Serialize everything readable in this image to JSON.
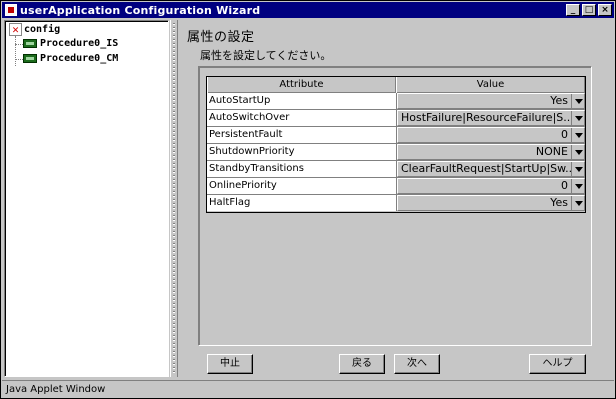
{
  "window": {
    "title": "userApplication Configuration Wizard",
    "controls": [
      "_",
      "□",
      "×"
    ]
  },
  "tree": {
    "root_label": "config",
    "items": [
      {
        "label": "Procedure0_IS"
      },
      {
        "label": "Procedure0_CM"
      }
    ]
  },
  "page": {
    "title": "属性の設定",
    "subtitle": "属性を設定してください。"
  },
  "table": {
    "headers": {
      "attribute": "Attribute",
      "value": "Value"
    },
    "rows": [
      {
        "attribute": "AutoStartUp",
        "value": "Yes"
      },
      {
        "attribute": "AutoSwitchOver",
        "value": "HostFailure|ResourceFailure|S..."
      },
      {
        "attribute": "PersistentFault",
        "value": "0"
      },
      {
        "attribute": "ShutdownPriority",
        "value": "NONE"
      },
      {
        "attribute": "StandbyTransitions",
        "value": "ClearFaultRequest|StartUp|Sw..."
      },
      {
        "attribute": "OnlinePriority",
        "value": "0"
      },
      {
        "attribute": "HaltFlag",
        "value": "Yes"
      }
    ]
  },
  "buttons": {
    "stop": "中止",
    "back": "戻る",
    "next": "次へ",
    "help": "ヘルプ"
  },
  "statusbar": {
    "text": "Java Applet Window"
  }
}
